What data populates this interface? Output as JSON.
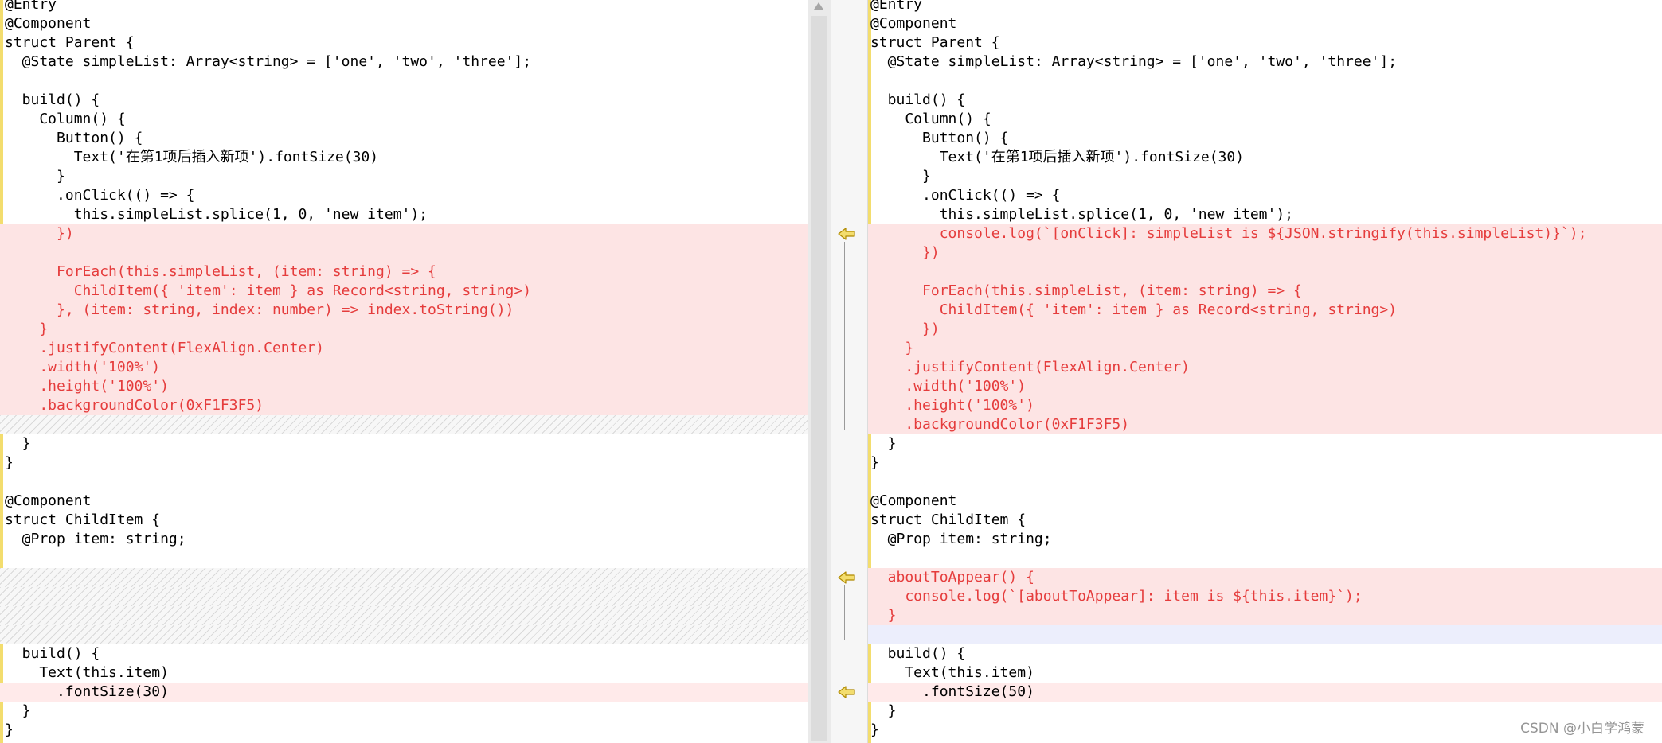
{
  "left_pane": {
    "lines": [
      {
        "text": "@Entry",
        "kind": "normal"
      },
      {
        "text": "@Component",
        "kind": "normal"
      },
      {
        "text": "struct Parent {",
        "kind": "normal"
      },
      {
        "text": "  @State simpleList: Array<string> = ['one', 'two', 'three'];",
        "kind": "normal"
      },
      {
        "text": "",
        "kind": "normal"
      },
      {
        "text": "  build() {",
        "kind": "normal"
      },
      {
        "text": "    Column() {",
        "kind": "normal"
      },
      {
        "text": "      Button() {",
        "kind": "normal"
      },
      {
        "text": "        Text('在第1项后插入新项').fontSize(30)",
        "kind": "normal"
      },
      {
        "text": "      }",
        "kind": "normal"
      },
      {
        "text": "      .onClick(() => {",
        "kind": "normal"
      },
      {
        "text": "        this.simpleList.splice(1, 0, 'new item');",
        "kind": "normal"
      },
      {
        "text": "      })",
        "kind": "changed"
      },
      {
        "text": "",
        "kind": "changed"
      },
      {
        "text": "      ForEach(this.simpleList, (item: string) => {",
        "kind": "changed"
      },
      {
        "text": "        ChildItem({ 'item': item } as Record<string, string>)",
        "kind": "changed"
      },
      {
        "text": "      }, (item: string, index: number) => index.toString())",
        "kind": "changed"
      },
      {
        "text": "    }",
        "kind": "changed"
      },
      {
        "text": "    .justifyContent(FlexAlign.Center)",
        "kind": "changed"
      },
      {
        "text": "    .width('100%')",
        "kind": "changed"
      },
      {
        "text": "    .height('100%')",
        "kind": "changed"
      },
      {
        "text": "    .backgroundColor(0xF1F3F5)",
        "kind": "changed"
      },
      {
        "text": "",
        "kind": "filler"
      },
      {
        "text": "  }",
        "kind": "normal"
      },
      {
        "text": "}",
        "kind": "normal"
      },
      {
        "text": "",
        "kind": "normal"
      },
      {
        "text": "@Component",
        "kind": "normal"
      },
      {
        "text": "struct ChildItem {",
        "kind": "normal"
      },
      {
        "text": "  @Prop item: string;",
        "kind": "normal"
      },
      {
        "text": "",
        "kind": "normal"
      },
      {
        "text": "",
        "kind": "filler"
      },
      {
        "text": "",
        "kind": "filler"
      },
      {
        "text": "",
        "kind": "filler"
      },
      {
        "text": "",
        "kind": "filler"
      },
      {
        "text": "  build() {",
        "kind": "normal"
      },
      {
        "text": "    Text(this.item)",
        "kind": "normal"
      },
      {
        "text": "      .fontSize(30)",
        "kind": "light"
      },
      {
        "text": "  }",
        "kind": "normal"
      },
      {
        "text": "}",
        "kind": "normal"
      }
    ]
  },
  "right_pane": {
    "lines": [
      {
        "text": "@Entry",
        "kind": "normal"
      },
      {
        "text": "@Component",
        "kind": "normal"
      },
      {
        "text": "struct Parent {",
        "kind": "normal"
      },
      {
        "text": "  @State simpleList: Array<string> = ['one', 'two', 'three'];",
        "kind": "normal"
      },
      {
        "text": "",
        "kind": "normal"
      },
      {
        "text": "  build() {",
        "kind": "normal"
      },
      {
        "text": "    Column() {",
        "kind": "normal"
      },
      {
        "text": "      Button() {",
        "kind": "normal"
      },
      {
        "text": "        Text('在第1项后插入新项').fontSize(30)",
        "kind": "normal"
      },
      {
        "text": "      }",
        "kind": "normal"
      },
      {
        "text": "      .onClick(() => {",
        "kind": "normal"
      },
      {
        "text": "        this.simpleList.splice(1, 0, 'new item');",
        "kind": "normal"
      },
      {
        "text": "        console.log(`[onClick]: simpleList is ${JSON.stringify(this.simpleList)}`);",
        "kind": "changed"
      },
      {
        "text": "      })",
        "kind": "changed"
      },
      {
        "text": "",
        "kind": "changed"
      },
      {
        "text": "      ForEach(this.simpleList, (item: string) => {",
        "kind": "changed"
      },
      {
        "text": "        ChildItem({ 'item': item } as Record<string, string>)",
        "kind": "changed"
      },
      {
        "text": "      })",
        "kind": "changed"
      },
      {
        "text": "    }",
        "kind": "changed"
      },
      {
        "text": "    .justifyContent(FlexAlign.Center)",
        "kind": "changed"
      },
      {
        "text": "    .width('100%')",
        "kind": "changed"
      },
      {
        "text": "    .height('100%')",
        "kind": "changed"
      },
      {
        "text": "    .backgroundColor(0xF1F3F5)",
        "kind": "changed"
      },
      {
        "text": "  }",
        "kind": "normal"
      },
      {
        "text": "}",
        "kind": "normal"
      },
      {
        "text": "",
        "kind": "normal"
      },
      {
        "text": "@Component",
        "kind": "normal"
      },
      {
        "text": "struct ChildItem {",
        "kind": "normal"
      },
      {
        "text": "  @Prop item: string;",
        "kind": "normal"
      },
      {
        "text": "",
        "kind": "normal"
      },
      {
        "text": "  aboutToAppear() {",
        "kind": "changed"
      },
      {
        "text": "    console.log(`[aboutToAppear]: item is ${this.item}`);",
        "kind": "changed"
      },
      {
        "text": "  }",
        "kind": "changed"
      },
      {
        "text": "",
        "kind": "empty-blue"
      },
      {
        "text": "  build() {",
        "kind": "normal"
      },
      {
        "text": "    Text(this.item)",
        "kind": "normal"
      },
      {
        "text": "      .fontSize(50)",
        "kind": "light"
      },
      {
        "text": "  }",
        "kind": "normal"
      },
      {
        "text": "}",
        "kind": "normal"
      }
    ]
  },
  "gutter": {
    "merge_arrows": [
      {
        "icon": "merge-left-arrow-icon",
        "line": 12
      },
      {
        "icon": "merge-left-arrow-icon",
        "line": 30
      },
      {
        "icon": "merge-left-arrow-icon",
        "line": 36
      }
    ]
  },
  "watermark": "CSDN @小白学鸿蒙",
  "colors": {
    "changed_background": "#fde4e4",
    "changed_text": "#e53c3c",
    "margin_bar": "#f3dd6e",
    "arrow_fill": "#f3dd6e",
    "arrow_stroke": "#b08a00"
  }
}
